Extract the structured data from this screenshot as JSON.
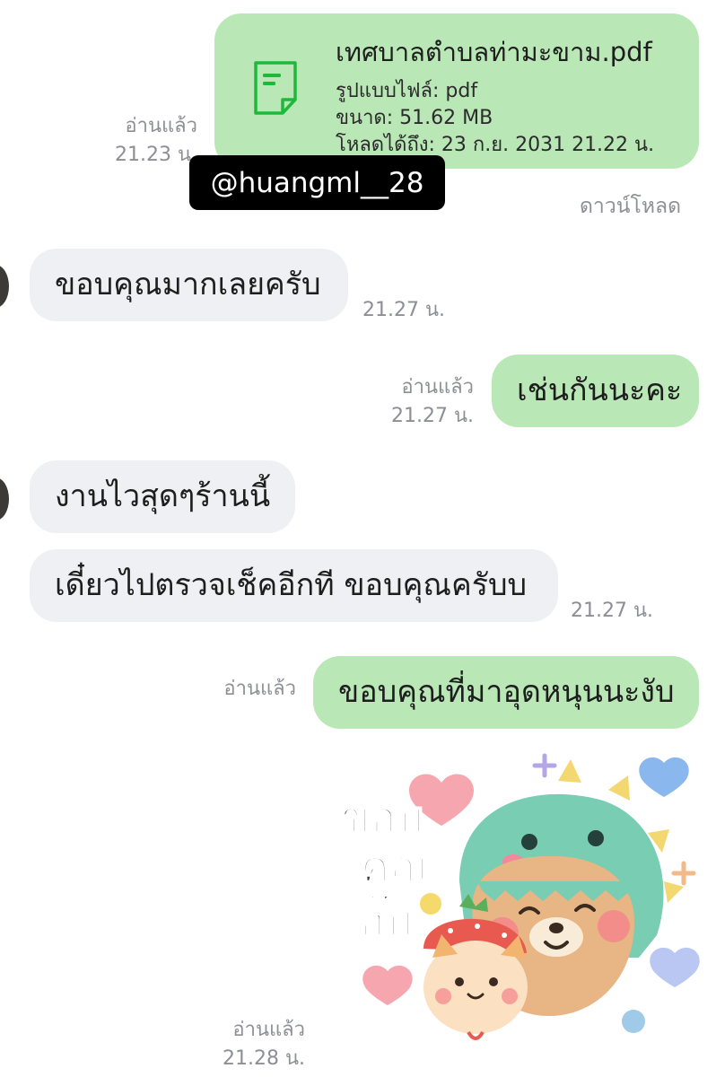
{
  "file_message": {
    "filename": "เทศบาลตำบลท่ามะขาม.pdf",
    "format_line": "รูปแบบไฟล์: pdf",
    "size_line": "ขนาด: 51.62 MB",
    "expiry_line": "โหลดได้ถึง: 23 ก.ย. 2031 21.22 น.",
    "read_label": "อ่านแล้ว",
    "time": "21.23 น.",
    "download_label": "ดาวน์โหลด",
    "icon": "document-icon"
  },
  "watermark": "@huangml__28",
  "messages": [
    {
      "side": "in",
      "text": "ขอบคุณมากเลยครับ",
      "time": "21.27 น."
    },
    {
      "side": "out",
      "text": "เช่นกันนะคะ",
      "read": "อ่านแล้ว",
      "time": "21.27 น."
    },
    {
      "side": "in",
      "text": "งานไวสุดๆร้านนี้"
    },
    {
      "side": "in",
      "text": "เดี๋ยวไปตรวจเช็คอีกที ขอบคุณครับบ",
      "time": "21.27 น."
    },
    {
      "side": "out",
      "text": "ขอบคุณที่มาอุดหนุนนะงับ",
      "read": "อ่านแล้ว"
    }
  ],
  "sticker": {
    "text_lines": [
      "ขอบ",
      "คุณ",
      "ฮั๊บ"
    ],
    "read": "อ่านแล้ว",
    "time": "21.28 น."
  },
  "colors": {
    "outgoing_bubble": "#b9e8b6",
    "incoming_bubble": "#eff0f3",
    "meta_text": "#8d8f94",
    "file_icon": "#1fb83a"
  }
}
